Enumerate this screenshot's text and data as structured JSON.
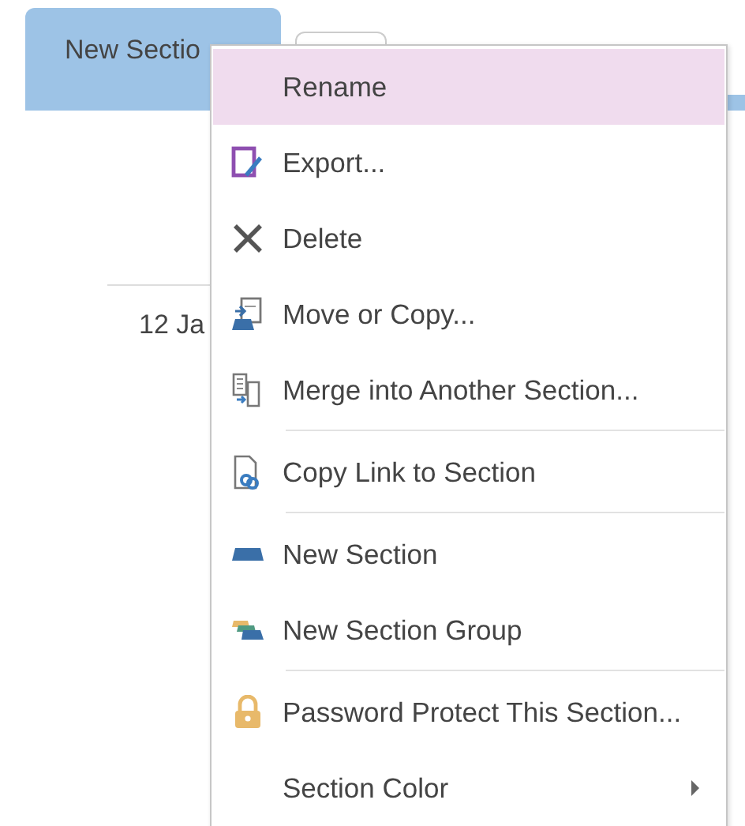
{
  "section_tabs": [
    {
      "label": "New Sectio",
      "selected": true
    },
    {
      "selected": false
    }
  ],
  "page": {
    "date": "12 Ja"
  },
  "context_menu": {
    "items": [
      {
        "label": "Rename",
        "selected": true,
        "separator_after": false,
        "submenu": false
      },
      {
        "label": "Export...",
        "selected": false,
        "separator_after": false,
        "submenu": false
      },
      {
        "label": "Delete",
        "selected": false,
        "separator_after": false,
        "submenu": false
      },
      {
        "label": "Move or Copy...",
        "selected": false,
        "separator_after": false,
        "submenu": false
      },
      {
        "label": "Merge into Another Section...",
        "selected": false,
        "separator_after": true,
        "submenu": false
      },
      {
        "label": "Copy Link to Section",
        "selected": false,
        "separator_after": true,
        "submenu": false
      },
      {
        "label": "New Section",
        "selected": false,
        "separator_after": false,
        "submenu": false
      },
      {
        "label": "New Section Group",
        "selected": false,
        "separator_after": true,
        "submenu": false
      },
      {
        "label": "Password Protect This Section...",
        "selected": false,
        "separator_after": false,
        "submenu": false
      },
      {
        "label": "Section Color",
        "selected": false,
        "separator_after": false,
        "submenu": true
      }
    ]
  }
}
